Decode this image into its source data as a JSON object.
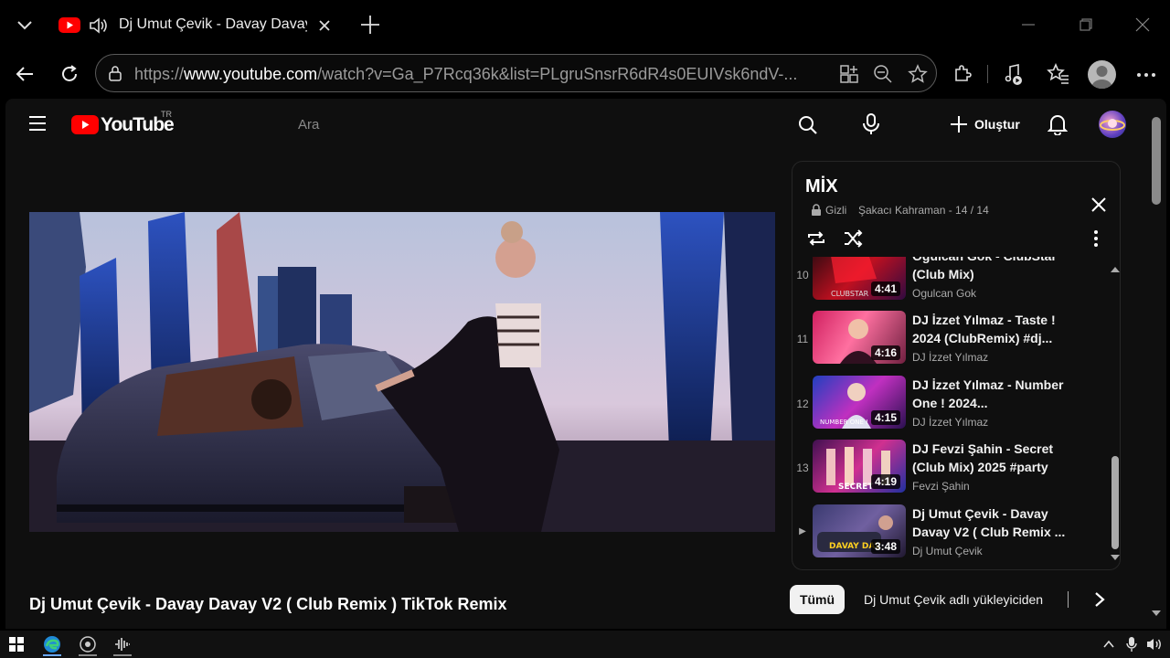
{
  "browser": {
    "tab_title": "Dj Umut Çevik - Davay Davay V",
    "url_prefix": "https://",
    "url_domain": "www.youtube.com",
    "url_rest": "/watch?v=Ga_P7Rcq36k&list=PLgruSnsrR6dR4s0EUIVsk6ndV-..."
  },
  "youtube": {
    "logo_text": "YouTube",
    "region": "TR",
    "search_placeholder": "Ara",
    "create_label": "Oluştur"
  },
  "video": {
    "title": "Dj Umut Çevik - Davay Davay V2 ( Club Remix ) TikTok Remix"
  },
  "mix": {
    "title": "MİX",
    "privacy": "Gizli",
    "owner_progress": "Şakacı Kahraman - 14 / 14",
    "items": [
      {
        "num": "10",
        "title": "Ogulcan Gok - ClubStar (Club Mix)",
        "channel": "Ogulcan Gok",
        "duration": "4:41"
      },
      {
        "num": "11",
        "title": "DJ İzzet Yılmaz - Taste ! 2024 (ClubRemix) #dj...",
        "channel": "DJ İzzet Yılmaz",
        "duration": "4:16"
      },
      {
        "num": "12",
        "title": "DJ İzzet Yılmaz - Number One ! 2024...",
        "channel": "DJ İzzet Yılmaz",
        "duration": "4:15"
      },
      {
        "num": "13",
        "title": "DJ Fevzi Şahin - Secret (Club Mix) 2025 #party",
        "channel": "Fevzi Şahin",
        "duration": "4:19"
      },
      {
        "num": "▶",
        "title": "Dj Umut Çevik - Davay Davay V2 ( Club Remix ...",
        "channel": "Dj Umut Çevik",
        "duration": "3:48"
      }
    ]
  },
  "chips": {
    "all": "Tümü",
    "uploader": "Dj Umut Çevik adlı yükleyiciden"
  },
  "colors": {
    "youtube_red": "#ff0000",
    "background": "#0f0f0f",
    "chip_active": "#f1f1f1"
  }
}
